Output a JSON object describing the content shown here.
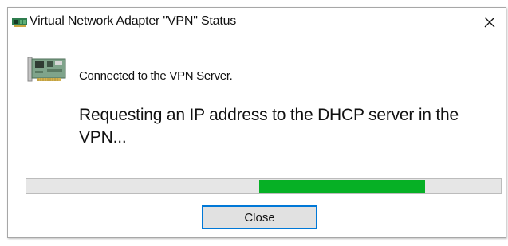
{
  "window": {
    "title": "Virtual Network Adapter \"VPN\" Status",
    "icons": {
      "title": "network-adapter-icon",
      "close": "close-icon",
      "adapter": "network-card-icon"
    }
  },
  "status": {
    "connected": "Connected to the VPN Server.",
    "message": "Requesting an IP address to the DHCP server in the VPN..."
  },
  "progress": {
    "mode": "marquee",
    "highlight_start": 0.49,
    "highlight_end": 0.84,
    "color": "#06b025"
  },
  "buttons": {
    "close_label": "Close"
  },
  "colors": {
    "accent": "#0078d7",
    "progress_track": "#e6e6e6",
    "button_face": "#e1e1e1"
  }
}
